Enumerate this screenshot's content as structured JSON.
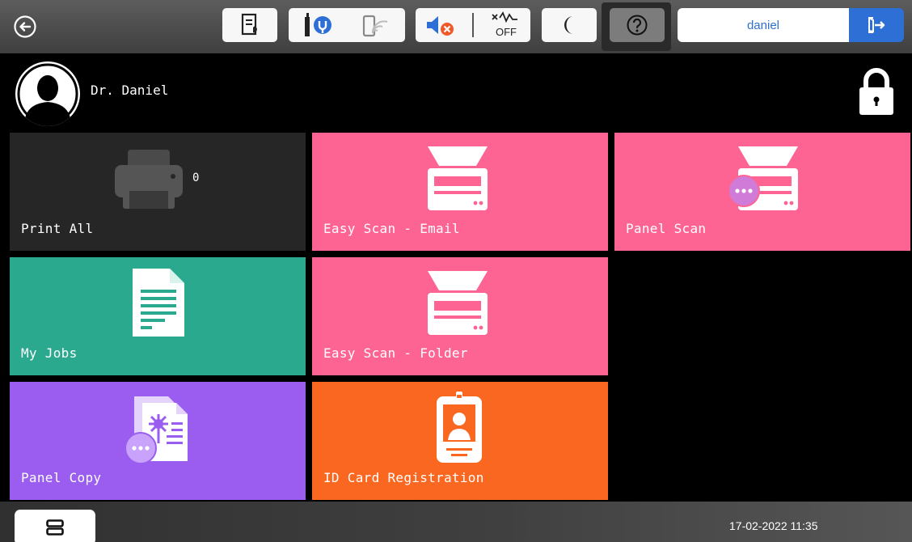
{
  "user": {
    "display_name": "Dr. Daniel",
    "login": "daniel"
  },
  "toolbar": {
    "icons": [
      "back-icon",
      "printer-status-icon",
      "nfc-reader-icon",
      "wifi-icon",
      "sound-muted-icon",
      "signal-off-icon",
      "sleep-mode-icon",
      "help-icon",
      "logout-icon"
    ],
    "signal_off_label": "OFF"
  },
  "tiles": [
    {
      "id": "print-all",
      "label": "Print All",
      "count": "0",
      "color": "#262626",
      "icon": "printer-icon"
    },
    {
      "id": "easy-scan-email",
      "label": "Easy Scan - Email",
      "color": "#fd6494",
      "icon": "scanner-icon"
    },
    {
      "id": "panel-scan",
      "label": "Panel Scan",
      "color": "#fd6494",
      "icon": "scanner-more-icon"
    },
    {
      "id": "my-jobs",
      "label": "My Jobs",
      "color": "#2aa98f",
      "icon": "document-icon"
    },
    {
      "id": "easy-scan-folder",
      "label": "Easy Scan - Folder",
      "color": "#fd6494",
      "icon": "scanner-icon"
    },
    {
      "id": "panel-copy",
      "label": "Panel Copy",
      "color": "#9a5df0",
      "icon": "copy-more-icon"
    },
    {
      "id": "id-card-registration",
      "label": "ID Card Registration",
      "color": "#fa6720",
      "icon": "id-card-icon"
    }
  ],
  "footer": {
    "datetime": "17-02-2022 11:35"
  },
  "colors": {
    "accent_blue": "#2e6fd6",
    "pink": "#fd6494",
    "teal": "#2aa98f",
    "purple": "#9a5df0",
    "orange": "#fa6720",
    "dark_tile": "#262626"
  }
}
